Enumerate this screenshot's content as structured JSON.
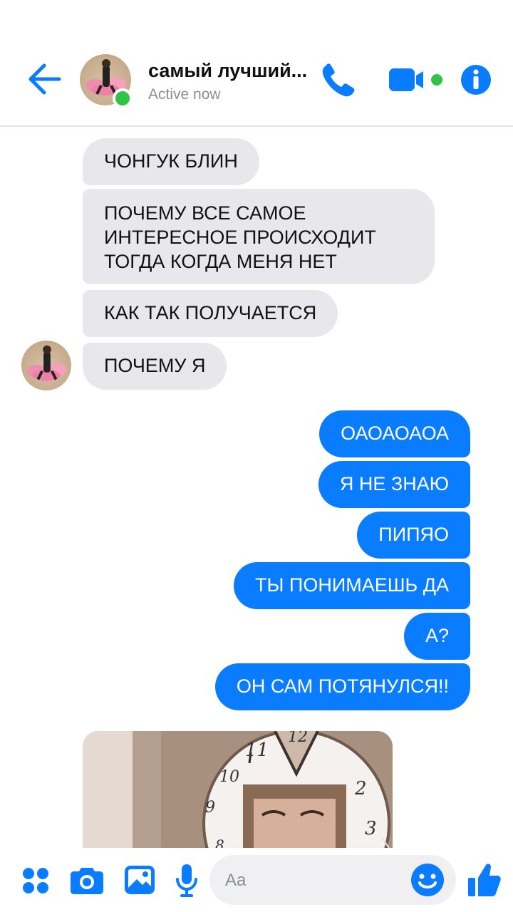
{
  "header": {
    "contact_name": "самый лучший...",
    "status": "Active now"
  },
  "messages": {
    "incoming": [
      "ЧОНГУК БЛИН",
      "ПОЧЕМУ ВСЕ САМОЕ",
      "ИНТЕРЕСНОЕ ПРОИСХОДИТ",
      "ТОГДА КОГДА МЕНЯ НЕТ",
      "КАК ТАК ПОЛУЧАЕТСЯ",
      "ПОЧЕМУ Я"
    ],
    "outgoing": [
      "ОАОАОАОА",
      "Я НЕ ЗНАЮ",
      "ПИПЯО",
      "ТЫ ПОНИМАЕШЬ ДА",
      "А?",
      "ОН САМ ПОТЯНУЛСЯ!!"
    ]
  },
  "photo": {
    "clock_numbers": [
      "11",
      "12",
      "10",
      "9",
      "2",
      "3",
      "8"
    ]
  },
  "composer": {
    "placeholder": "Aa"
  },
  "colors": {
    "accent": "#0a7cff",
    "incoming_bubble": "#e8e8ec",
    "presence": "#31c343"
  }
}
